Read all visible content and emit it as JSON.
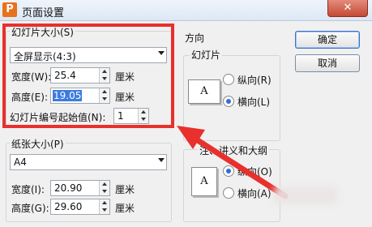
{
  "window": {
    "title": "页面设置",
    "app_icon": "wps-presentation-icon",
    "close_glyph": "✕"
  },
  "slide_size": {
    "label": "幻灯片大小(S)",
    "preset": "全屏显示(4:3)",
    "width_label": "宽度(W):",
    "width_value": "25.4",
    "height_label": "高度(E):",
    "height_value": "19.05",
    "unit": "厘米",
    "numbering_label": "幻灯片编号起始值(N):",
    "numbering_value": "1"
  },
  "paper_size": {
    "label": "纸张大小(P)",
    "preset": "A4",
    "width_label": "宽度(I):",
    "width_value": "20.90",
    "height_label": "高度(G):",
    "height_value": "29.60",
    "unit": "厘米"
  },
  "orientation": {
    "label": "方向",
    "slides": {
      "label": "幻灯片",
      "portrait": "纵向(R)",
      "landscape": "横向(L)",
      "selected": "landscape",
      "icon_letter": "A"
    },
    "notes": {
      "label": "备注、讲义和大纲",
      "visible_label": "注、讲义和大纲",
      "portrait": "纵向(O)",
      "landscape": "横向(A)",
      "selected": "portrait",
      "icon_letter": "A"
    }
  },
  "buttons": {
    "ok": "确定",
    "cancel": "取消"
  },
  "annotation": {
    "color": "#e8302c"
  }
}
